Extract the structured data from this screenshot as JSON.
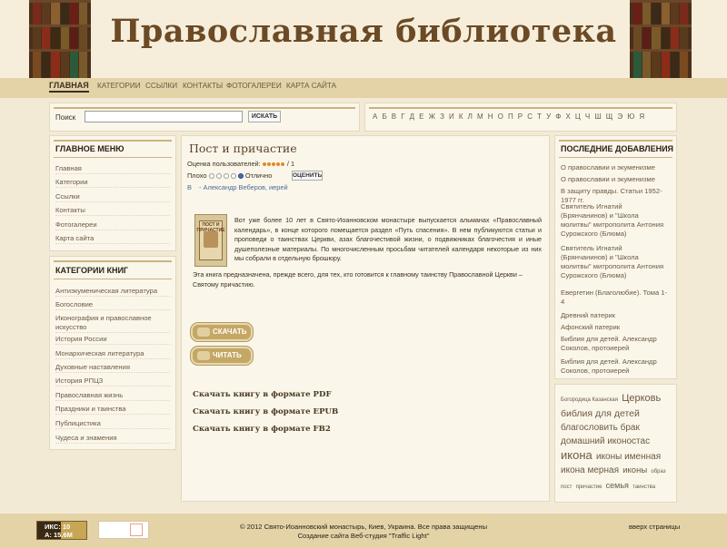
{
  "header": {
    "title": "Православная библиотека"
  },
  "nav": {
    "items": [
      "ГЛАВНАЯ",
      "КАТЕГОРИИ",
      "ССЫЛКИ",
      "КОНТАКТЫ",
      "ФОТОГАЛЕРЕИ",
      "КАРТА САЙТА"
    ],
    "active_index": 0
  },
  "search": {
    "label": "Поиск",
    "value": "",
    "button": "ИСКАТЬ"
  },
  "alphabet": [
    "А",
    "Б",
    "В",
    "Г",
    "Д",
    "Е",
    "Ж",
    "З",
    "И",
    "К",
    "Л",
    "М",
    "Н",
    "О",
    "П",
    "Р",
    "С",
    "Т",
    "У",
    "Ф",
    "Х",
    "Ц",
    "Ч",
    "Ш",
    "Щ",
    "Э",
    "Ю",
    "Я"
  ],
  "main_menu": {
    "title": "ГЛАВНОЕ МЕНЮ",
    "items": [
      "Главная",
      "Категории",
      "Ссылки",
      "Контакты",
      "Фотогалереи",
      "Карта сайта"
    ]
  },
  "book_categories": {
    "title": "КАТЕГОРИИ КНИГ",
    "items": [
      "Антиэкуменическая литература",
      "Богословие",
      "Иконография и православное искусство",
      "История России",
      "Монархическая литература",
      "Духовные наставления",
      "История РПЦЗ",
      "Православная жизнь",
      "Праздники и таинства",
      "Публицистика",
      "Чудеса и знамения"
    ]
  },
  "article": {
    "title": "Пост и причастие",
    "rating_label": "Оценка пользователей:",
    "rating_value": 5,
    "rating_max_label": "/ 1",
    "rate_bad": "Плохо",
    "rate_good": "Отлично",
    "rate_button": "ОЦЕНИТЬ",
    "category": "В",
    "author": "- Александр Веберов, иерей",
    "cover_title": "ПОСТ И ПРИЧАСТИЕ",
    "description": "Вот уже более 10 лет в Свято-Иоанновском монастыре выпускается альманах «Православный календарь», в конце которого помещается раздел «Путь спасения». В нем публикуются статьи и проповеди о таинствах Церкви, азах благочестивой жизни, о подвижниках благочестия и иные душеполезные материалы. По многочисленным просьбам читателей календаря некоторые из них мы собрали в отдельную брошюру.",
    "description2": "Эта книга предназначена, прежде всего, для тех, кто готовится к главному таинству Православной Церкви – Святому причастию.",
    "download_button": "СКАЧАТЬ",
    "read_button": "ЧИТАТЬ",
    "downloads": [
      "Скачать книгу в формате PDF",
      "Скачать книгу в формате EPUB",
      "Скачать книгу в формате FB2"
    ]
  },
  "recent": {
    "title": "ПОСЛЕДНИЕ ДОБАВЛЕНИЯ",
    "items": [
      "О православии и экуменизме",
      "О православии и экуменизме",
      "В защиту правды. Статьи 1952-1977 гг.",
      "Святитель Игнатий (Брянчанинов) и \"Школа молитвы\" митрополита Антония Сурожского (Блюма)",
      "Святитель Игнатий (Брянчанинов) и \"Школа молитвы\" митрополита Антония Сурожского (Блюма)",
      "Евергетин (Благолюбие). Тома 1-4",
      "Древний патерик",
      "Афонский патерик",
      "Библия для детей. Александр Соколов, протоиерей",
      "Библия для детей. Александр Соколов, протоиерей"
    ]
  },
  "tags": [
    {
      "text": "Богородица Казанская",
      "size": 6
    },
    {
      "text": "Церковь",
      "size": 11
    },
    {
      "text": "библия для детей",
      "size": 10.5
    },
    {
      "text": "благословить брак",
      "size": 10
    },
    {
      "text": "домашний иконостас",
      "size": 10
    },
    {
      "text": "икона",
      "size": 13
    },
    {
      "text": "иконы именная",
      "size": 10
    },
    {
      "text": "икона мерная",
      "size": 10
    },
    {
      "text": "иконы",
      "size": 9.5
    },
    {
      "text": "образ",
      "size": 6
    },
    {
      "text": "пост",
      "size": 6
    },
    {
      "text": "причастие",
      "size": 6
    },
    {
      "text": "семья",
      "size": 9
    },
    {
      "text": "таинства",
      "size": 6
    }
  ],
  "footer": {
    "copyright": "© 2012 Свято-Иоанновский монастырь, Киев, Украина. Все права защищены",
    "credit": "Создание сайта Веб-студия \"Traffic Light\"",
    "back_top": "вверх страницы",
    "counter_line1": "ИКС: 10",
    "counter_line2": "А: 15.6М"
  },
  "colors": {
    "accent": "#c9b37f",
    "nav_bg": "#e3d3a7",
    "title": "#6b4a25"
  }
}
